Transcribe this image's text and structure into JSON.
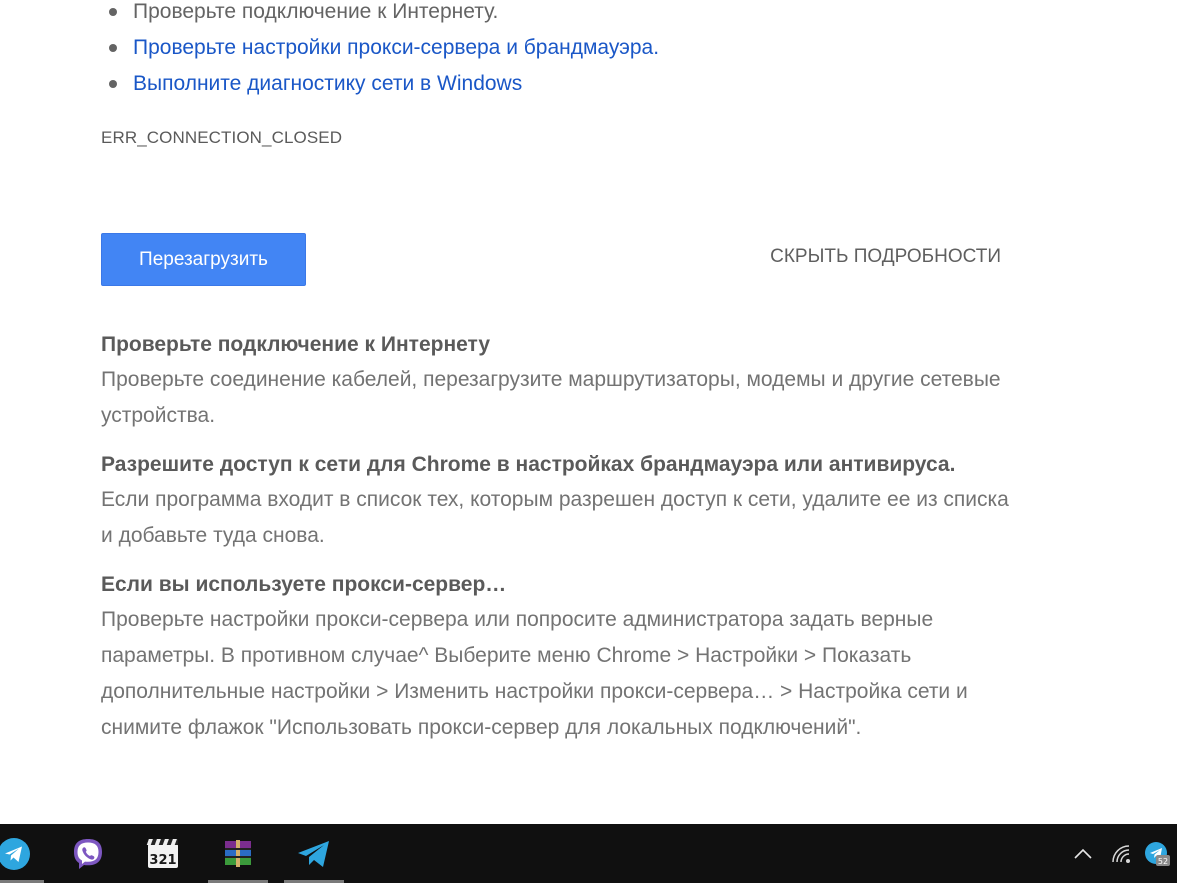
{
  "suggestions": [
    {
      "text": "Проверьте подключение к Интернету.",
      "link": false
    },
    {
      "text": "Проверьте настройки прокси-сервера и брандмауэра.",
      "link": true
    },
    {
      "text": "Выполните диагностику сети в Windows",
      "link": true
    }
  ],
  "error_code": "ERR_CONNECTION_CLOSED",
  "buttons": {
    "reload": "Перезагрузить",
    "hide_details": "СКРЫТЬ ПОДРОБНОСТИ"
  },
  "details": [
    {
      "title": "Проверьте подключение к Интернету",
      "body": "Проверьте соединение кабелей, перезагрузите маршрутизаторы, модемы и другие сетевые устройства."
    },
    {
      "title": "Разрешите доступ к сети для Chrome в настройках брандмауэра или антивируса.",
      "body": "Если программа входит в список тех, которым разрешен доступ к сети, удалите ее из списка и добавьте туда снова."
    },
    {
      "title": "Если вы используете прокси-сервер…",
      "body": "Проверьте настройки прокси-сервера или попросите администратора задать верные параметры. В противном случае^ Выберите меню Chrome > Настройки > Показать дополнительные настройки > Изменить настройки прокси-сервера… > Настройка сети и снимите флажок \"Использовать прокси-сервер для локальных подключений\"."
    }
  ],
  "taskbar": {
    "apps": [
      {
        "name": "telegram-icon",
        "active": true
      },
      {
        "name": "viber-icon",
        "active": false
      },
      {
        "name": "media-player-classic-icon",
        "active": false
      },
      {
        "name": "winrar-icon",
        "active": true
      },
      {
        "name": "paper-plane-icon",
        "active": true
      }
    ],
    "tray": {
      "icons": [
        "chevron-up-icon",
        "wifi-icon",
        "telegram-tray-icon"
      ],
      "badge": "52"
    }
  },
  "colors": {
    "accent": "#4285f4",
    "link": "#1a57c7",
    "text": "#646464",
    "taskbar": "#101010"
  }
}
